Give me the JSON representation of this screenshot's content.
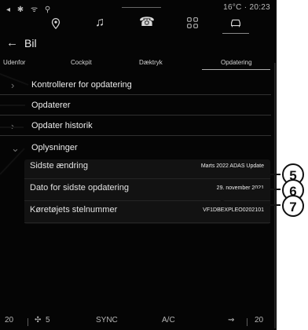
{
  "status_bar": {
    "temperature": "16°C",
    "time": "20:23"
  },
  "top_nav": {
    "icons": [
      "location-icon",
      "music-icon",
      "phone-icon",
      "apps-icon",
      "car-icon"
    ]
  },
  "header": {
    "title": "Bil"
  },
  "tabs": [
    {
      "label": "Udenfor"
    },
    {
      "label": "Cockpit"
    },
    {
      "label": "Dæktryk"
    },
    {
      "label": "Opdatering"
    }
  ],
  "menu": {
    "items": [
      {
        "label": "Kontrollerer for opdatering"
      },
      {
        "label": "Opdaterer"
      },
      {
        "label": "Opdater historik"
      },
      {
        "label": "Oplysninger"
      }
    ]
  },
  "details": {
    "rows": [
      {
        "label": "Sidste ændring",
        "value": "Marts 2022 ADAS Update"
      },
      {
        "label": "Dato for sidste opdatering",
        "value": "29. november 2021"
      },
      {
        "label": "Køretøjets stelnummer",
        "value": "VF1DBEXPLEO0202101"
      }
    ]
  },
  "bottom_bar": {
    "left_temp": "20",
    "fan_level": "5",
    "sync": "SYNC",
    "ac": "A/C",
    "right_temp": "20"
  },
  "callouts": [
    "5",
    "6",
    "7"
  ],
  "colors": {
    "screen_bg": "#050505",
    "panel_bg": "#121212",
    "text": "#ececec",
    "muted": "#747474",
    "annotation": "#111111"
  }
}
